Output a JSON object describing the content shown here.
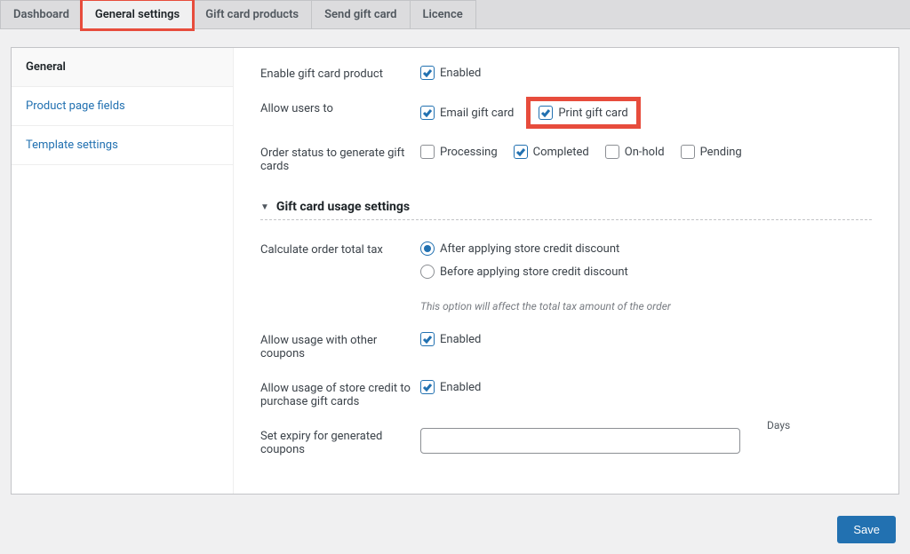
{
  "tabs": {
    "dashboard": "Dashboard",
    "general_settings": "General settings",
    "gift_card_products": "Gift card products",
    "send_gift_card": "Send gift card",
    "licence": "Licence"
  },
  "sidebar": {
    "general": "General",
    "product_page_fields": "Product page fields",
    "template_settings": "Template settings"
  },
  "form": {
    "enable_gift_card_product": {
      "label": "Enable gift card product",
      "enabled": "Enabled"
    },
    "allow_users_to": {
      "label": "Allow users to",
      "email_gift_card": "Email gift card",
      "print_gift_card": "Print gift card"
    },
    "order_status": {
      "label": "Order status to generate gift cards",
      "processing": "Processing",
      "completed": "Completed",
      "on_hold": "On-hold",
      "pending": "Pending"
    },
    "section_usage": "Gift card usage settings",
    "calc_tax": {
      "label": "Calculate order total tax",
      "after": "After applying store credit discount",
      "before": "Before applying store credit discount",
      "help": "This option will affect the total tax amount of the order"
    },
    "allow_other_coupons": {
      "label": "Allow usage with other coupons",
      "enabled": "Enabled"
    },
    "allow_store_credit": {
      "label": "Allow usage of store credit to purchase gift cards",
      "enabled": "Enabled"
    },
    "expiry": {
      "label": "Set expiry for generated coupons",
      "unit": "Days"
    }
  },
  "save_button": "Save"
}
